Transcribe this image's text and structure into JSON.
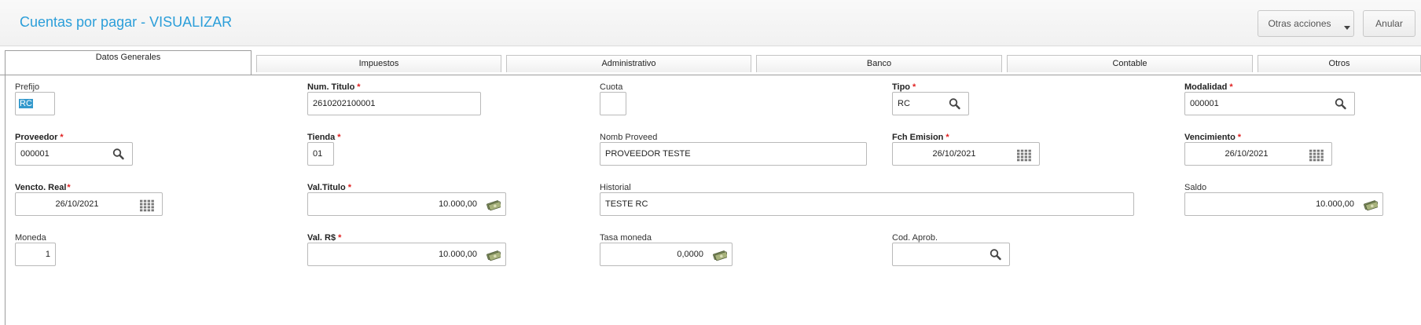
{
  "header": {
    "title": "Cuentas por pagar - VISUALIZAR",
    "otras_acciones": "Otras acciones",
    "anular": "Anular"
  },
  "tabs": [
    {
      "label": "Datos Generales",
      "active": true
    },
    {
      "label": "Impuestos",
      "active": false
    },
    {
      "label": "Administrativo",
      "active": false
    },
    {
      "label": "Banco",
      "active": false
    },
    {
      "label": "Contable",
      "active": false
    },
    {
      "label": "Otros",
      "active": false
    }
  ],
  "fields": {
    "prefijo": {
      "label": "Prefijo",
      "value": "RC"
    },
    "num_titulo": {
      "label": "Num. Titulo",
      "value": "2610202100001"
    },
    "cuota": {
      "label": "Cuota",
      "value": ""
    },
    "tipo": {
      "label": "Tipo",
      "value": "RC"
    },
    "modalidad": {
      "label": "Modalidad",
      "value": "000001"
    },
    "proveedor": {
      "label": "Proveedor",
      "value": "000001"
    },
    "tienda": {
      "label": "Tienda",
      "value": "01"
    },
    "nomb_proveed": {
      "label": "Nomb Proveed",
      "value": "PROVEEDOR TESTE"
    },
    "fch_emision": {
      "label": "Fch Emision",
      "value": "26/10/2021"
    },
    "vencimiento": {
      "label": "Vencimiento",
      "value": "26/10/2021"
    },
    "vencto_real": {
      "label": "Vencto. Real",
      "value": "26/10/2021"
    },
    "val_titulo": {
      "label": "Val.Titulo",
      "value": "10.000,00"
    },
    "historial": {
      "label": "Historial",
      "value": "TESTE RC"
    },
    "saldo": {
      "label": "Saldo",
      "value": "10.000,00"
    },
    "moneda": {
      "label": "Moneda",
      "value": "1"
    },
    "val_rs": {
      "label": "Val. R$",
      "value": "10.000,00"
    },
    "tasa_moneda": {
      "label": "Tasa moneda",
      "value": "0,0000"
    },
    "cod_aprob": {
      "label": "Cod. Aprob.",
      "value": ""
    }
  },
  "required_marker": "*",
  "colors": {
    "title": "#2b9ed9",
    "required": "#e02020",
    "selection": "#3399cc"
  }
}
